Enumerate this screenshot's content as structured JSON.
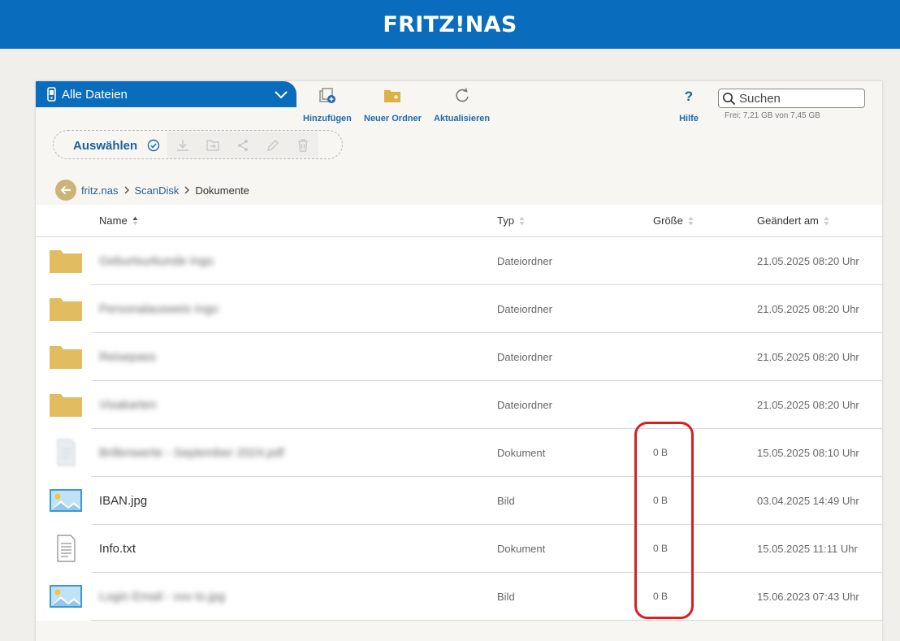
{
  "header": {
    "title": "FRITZ!NAS"
  },
  "drive": {
    "label": "Alle Dateien"
  },
  "toolbar": {
    "add_label": "Hinzufügen",
    "new_folder_label": "Neuer Ordner",
    "refresh_label": "Aktualisieren",
    "help_label": "Hilfe"
  },
  "search": {
    "placeholder": "Suchen"
  },
  "storage": {
    "text": "Frei: 7,21 GB von 7,45 GB"
  },
  "selection": {
    "label": "Auswählen"
  },
  "breadcrumb": {
    "items": [
      "fritz.nas",
      "ScanDisk",
      "Dokumente"
    ]
  },
  "columns": {
    "name": "Name",
    "type": "Typ",
    "size": "Größe",
    "modified": "Geändert am"
  },
  "files": [
    {
      "name": "Geburtsurkunde Ingo",
      "type": "Dateiordner",
      "size": "",
      "modified": "21.05.2025 08:20 Uhr",
      "icon": "folder-icon",
      "blurred": true
    },
    {
      "name": "Personalausweis Ingo",
      "type": "Dateiordner",
      "size": "",
      "modified": "21.05.2025 08:20 Uhr",
      "icon": "folder-icon",
      "blurred": true
    },
    {
      "name": "Reisepass",
      "type": "Dateiordner",
      "size": "",
      "modified": "21.05.2025 08:20 Uhr",
      "icon": "folder-icon",
      "blurred": true
    },
    {
      "name": "Visakarten",
      "type": "Dateiordner",
      "size": "",
      "modified": "21.05.2025 08:20 Uhr",
      "icon": "folder-icon",
      "blurred": true
    },
    {
      "name": "Brillenwerte - September 2024.pdf",
      "type": "Dokument",
      "size": "0 B",
      "modified": "15.05.2025 08:10 Uhr",
      "icon": "pdf-file-icon",
      "blurred": true
    },
    {
      "name": "IBAN.jpg",
      "type": "Bild",
      "size": "0 B",
      "modified": "03.04.2025 14:49 Uhr",
      "icon": "image-file-icon",
      "blurred": false
    },
    {
      "name": "Info.txt",
      "type": "Dokument",
      "size": "0 B",
      "modified": "15.05.2025 11:11 Uhr",
      "icon": "text-file-icon",
      "blurred": false
    },
    {
      "name": "Login Email - xxx to.jpg",
      "type": "Bild",
      "size": "0 B",
      "modified": "15.06.2023 07:43 Uhr",
      "icon": "image-file-icon",
      "blurred": true
    }
  ],
  "colors": {
    "brand": "#0a6cbc",
    "highlight": "#d7201f",
    "folder": "#dcb045"
  }
}
